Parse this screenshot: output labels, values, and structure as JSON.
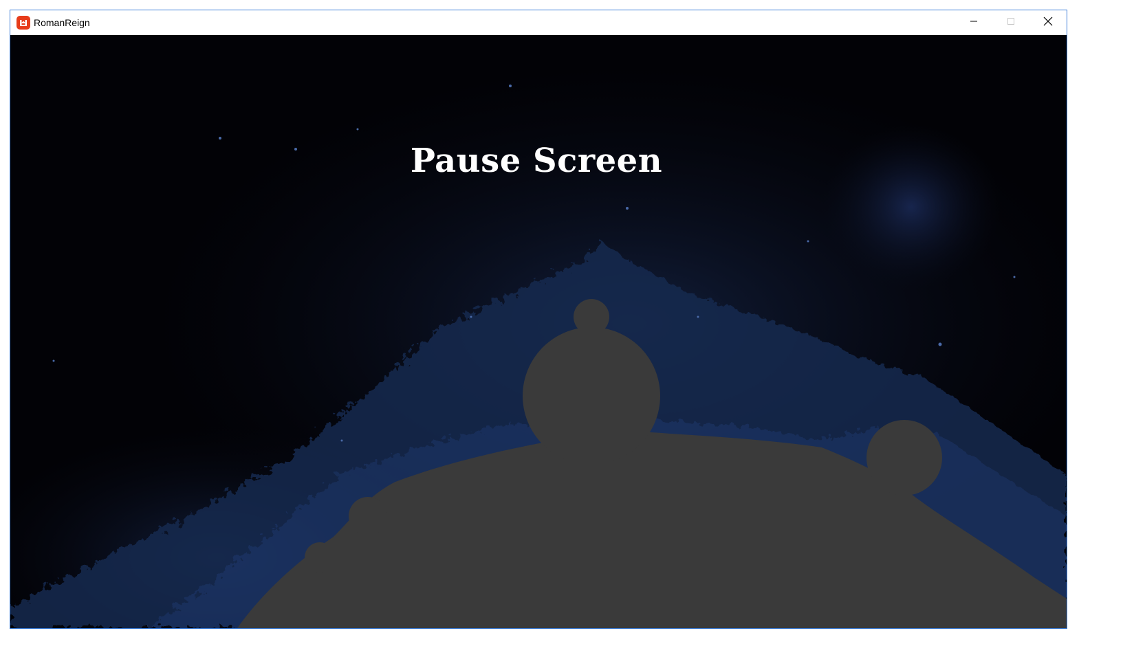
{
  "window": {
    "title": "RomanReign",
    "app_icon": "monogame-icon",
    "controls": {
      "minimize_icon": "minimize-icon",
      "maximize_icon": "maximize-icon",
      "close_icon": "close-icon"
    }
  },
  "game": {
    "screen_title": "Pause Screen",
    "background": "mandelbrot-fractal",
    "colors": {
      "background": "#020206",
      "fractal_edge": "#1c2f55",
      "fractal_interior": "#3b3b3b",
      "title_text": "#ffffff"
    }
  }
}
